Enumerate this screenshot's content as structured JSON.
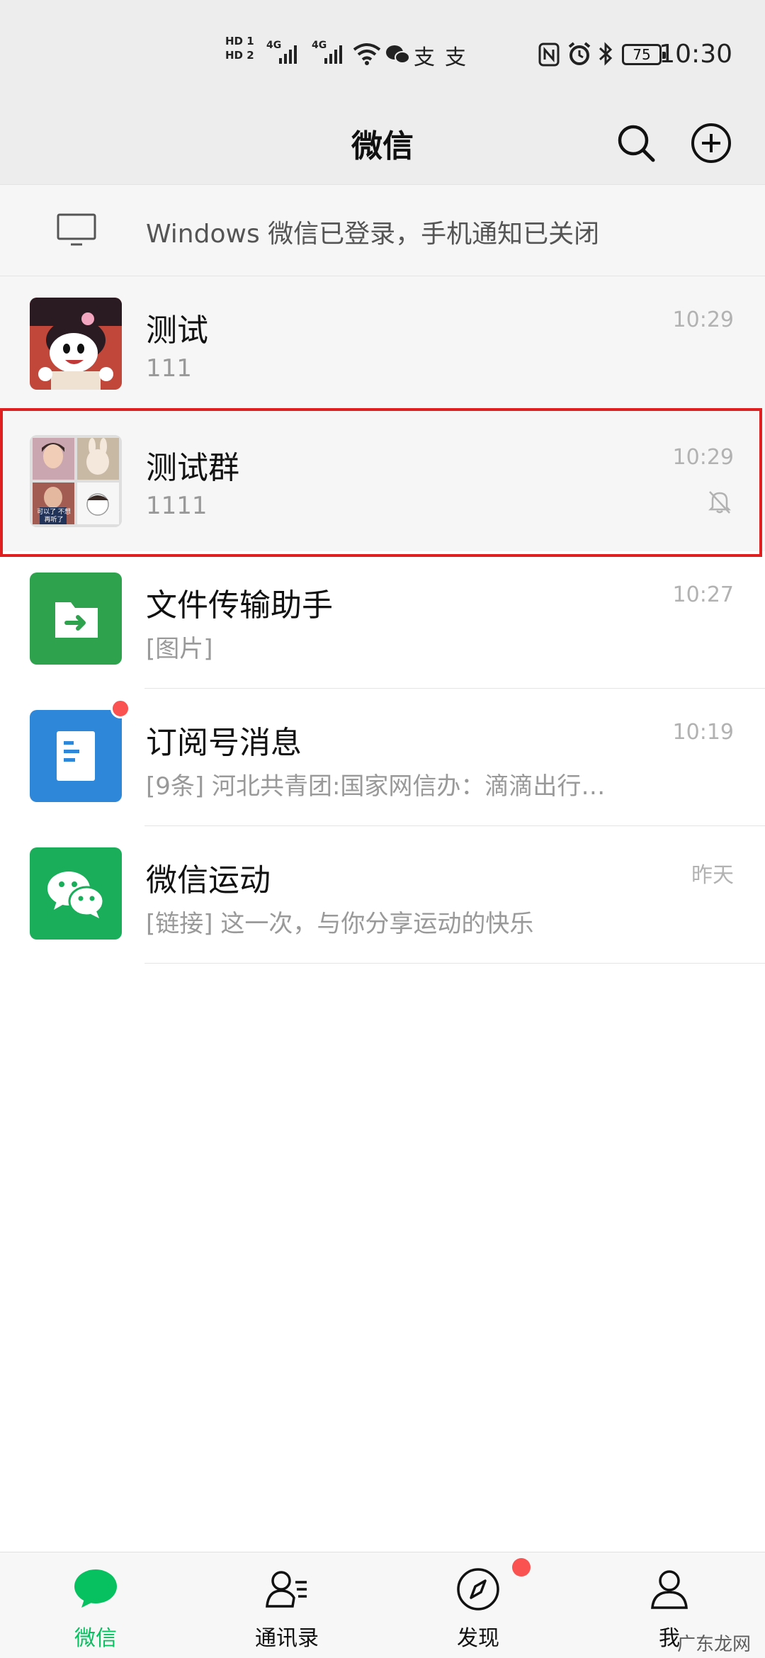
{
  "status_bar": {
    "hd1": "HD 1",
    "hd2": "HD 2",
    "net1": "4G",
    "net2": "4G",
    "battery": "75",
    "time": "10:30"
  },
  "nav": {
    "title": "微信",
    "search_icon": "search-icon",
    "add_icon": "plus-circle-icon"
  },
  "login_banner": {
    "icon": "monitor-icon",
    "text": "Windows 微信已登录，手机通知已关闭"
  },
  "chats": [
    {
      "name": "测试",
      "preview": "111",
      "time": "10:29",
      "muted": false,
      "unread_dot": false
    },
    {
      "name": "测试群",
      "preview": "1111",
      "time": "10:29",
      "muted": true,
      "unread_dot": false
    },
    {
      "name": "文件传输助手",
      "preview": "[图片]",
      "time": "10:27",
      "muted": false,
      "unread_dot": false
    },
    {
      "name": "订阅号消息",
      "preview": "[9条] 河北共青团:国家网信办：滴滴出行…",
      "time": "10:19",
      "muted": false,
      "unread_dot": true
    },
    {
      "name": "微信运动",
      "preview": "[链接] 这一次，与你分享运动的快乐",
      "time": "昨天",
      "muted": false,
      "unread_dot": false
    }
  ],
  "group_avatar_caption": "可以了 不想再听了",
  "tabs": [
    {
      "label": "微信",
      "icon": "chat-bubble-icon",
      "active": true
    },
    {
      "label": "通讯录",
      "icon": "contacts-icon",
      "active": false
    },
    {
      "label": "发现",
      "icon": "compass-icon",
      "active": false,
      "dot": true
    },
    {
      "label": "我",
      "icon": "person-icon",
      "active": false
    }
  ],
  "watermark": "广东龙网",
  "colors": {
    "accent": "#07c160",
    "badge": "#fa5151",
    "highlight": "#e02020"
  }
}
